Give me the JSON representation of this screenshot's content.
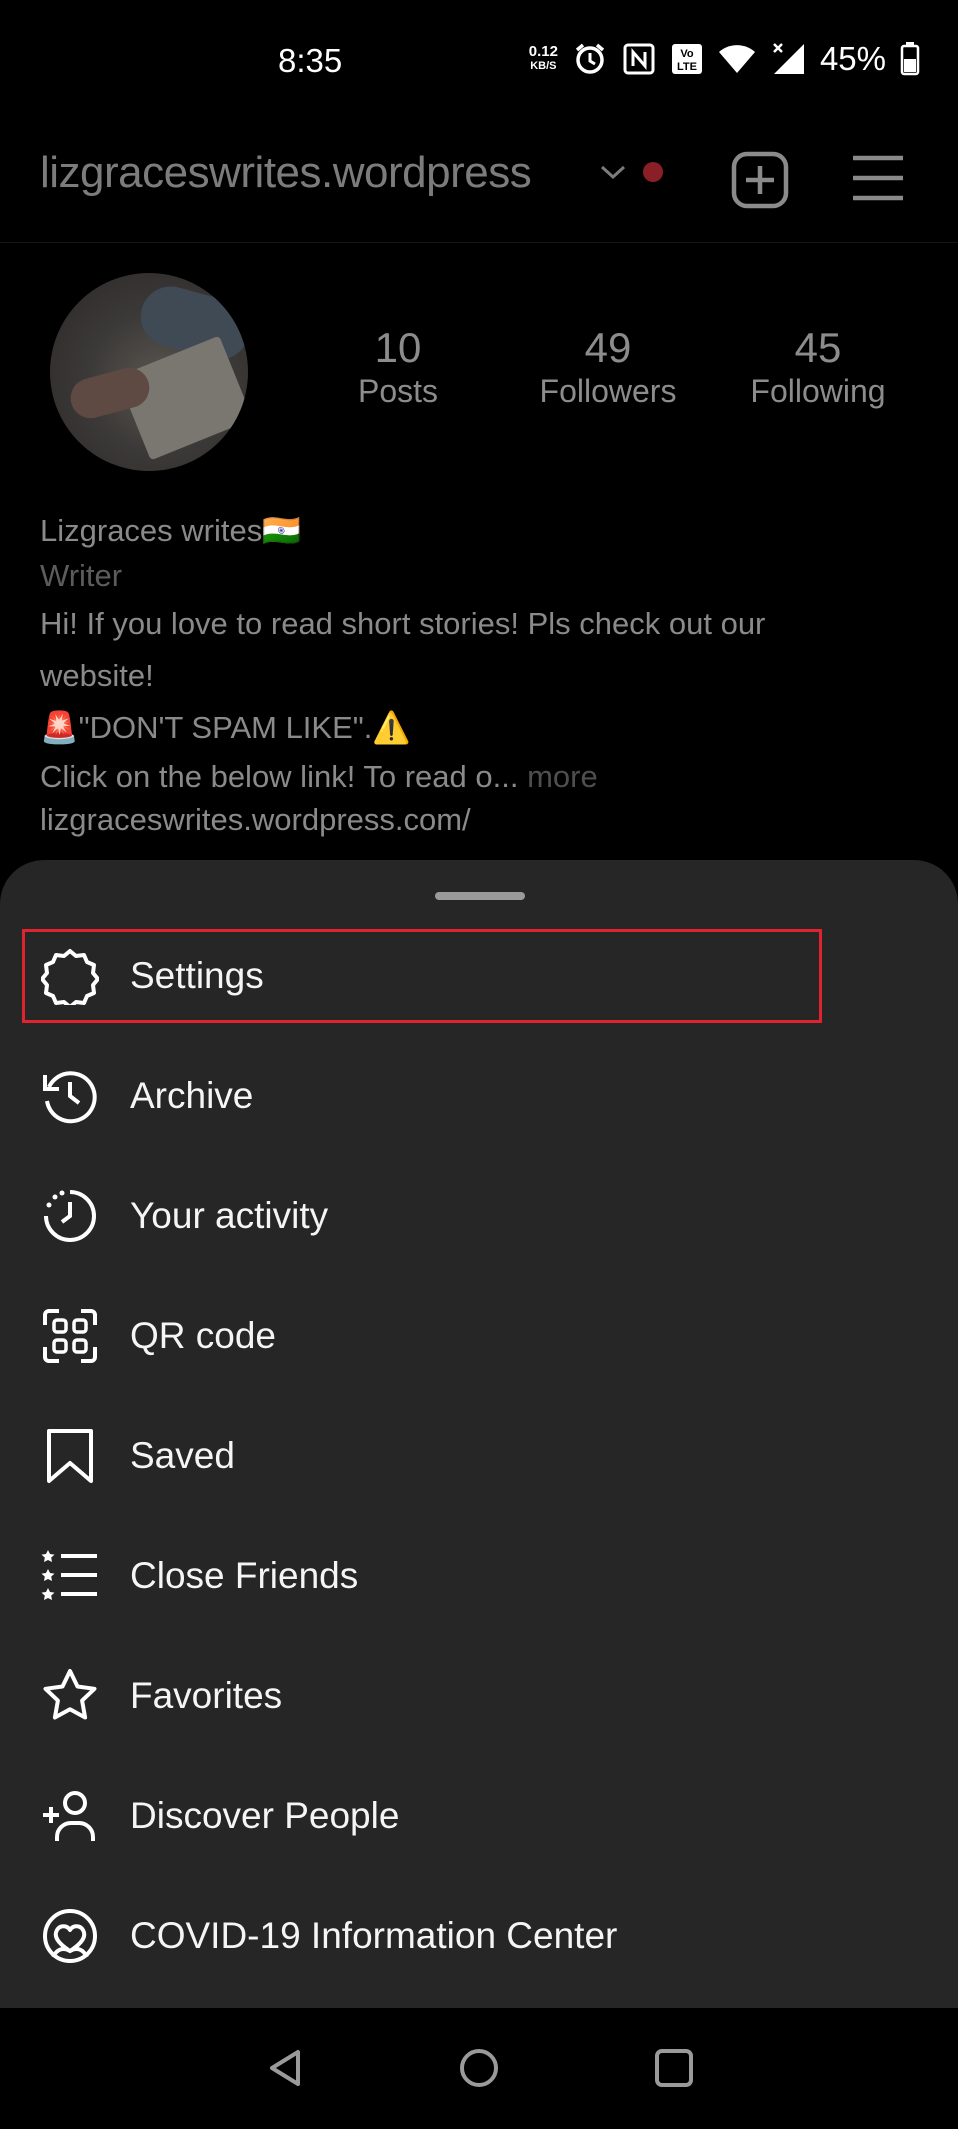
{
  "status_bar": {
    "time": "8:35",
    "speed_value": "0.12",
    "speed_unit": "KB/S",
    "volte": "Vo LTE",
    "battery_percent": "45%",
    "icons": [
      "alarm-icon",
      "nfc-icon",
      "volte-icon",
      "wifi-icon",
      "signal-icon",
      "battery-icon"
    ]
  },
  "header": {
    "username": "lizgraceswrites.wordpress",
    "icons": [
      "chevron-down-icon",
      "notification-dot",
      "new-post-icon",
      "menu-icon"
    ]
  },
  "profile": {
    "stats": [
      {
        "count": "10",
        "label": "Posts"
      },
      {
        "count": "49",
        "label": "Followers"
      },
      {
        "count": "45",
        "label": "Following"
      }
    ],
    "name": "Lizgraces writes🇮🇳",
    "category": "Writer",
    "bio_line1": "Hi! If you love to read short stories! Pls check out our",
    "bio_line2": "website!",
    "bio_line3": "🚨\"DON'T SPAM LIKE\".⚠️",
    "bio_line4": "Click on the below link! To read o...",
    "more_label": " more",
    "website": "lizgraceswrites.wordpress.com/"
  },
  "menu": {
    "highlight_color": "#e0242f",
    "items": [
      {
        "label": "Settings",
        "icon": "settings-icon"
      },
      {
        "label": "Archive",
        "icon": "archive-icon"
      },
      {
        "label": "Your activity",
        "icon": "activity-icon"
      },
      {
        "label": "QR code",
        "icon": "qr-code-icon"
      },
      {
        "label": "Saved",
        "icon": "saved-icon"
      },
      {
        "label": "Close Friends",
        "icon": "close-friends-icon"
      },
      {
        "label": "Favorites",
        "icon": "favorites-icon"
      },
      {
        "label": "Discover People",
        "icon": "discover-people-icon"
      },
      {
        "label": "COVID-19 Information Center",
        "icon": "covid-info-icon"
      }
    ]
  },
  "nav_bar": {
    "icons": [
      "back-icon",
      "home-icon",
      "recents-icon"
    ]
  }
}
